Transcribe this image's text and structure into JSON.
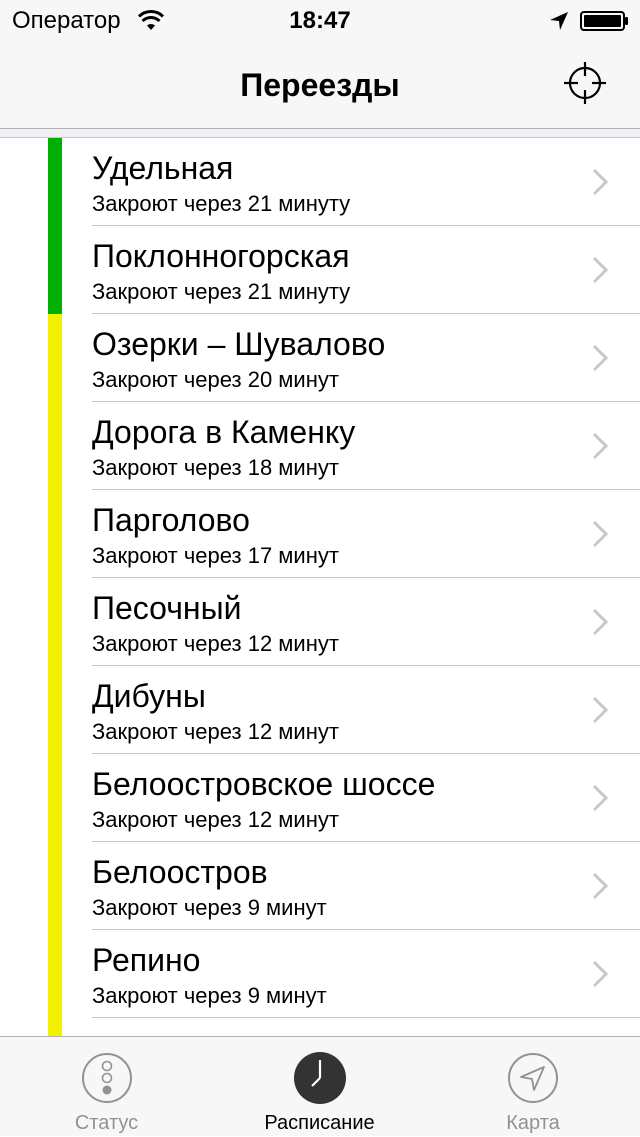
{
  "status_bar": {
    "carrier": "Оператор",
    "time": "18:47"
  },
  "nav": {
    "title": "Переезды"
  },
  "colors": {
    "green": "#00b000",
    "yellow": "#f2f200",
    "active_tab": "#333333",
    "inactive_tab": "#929292"
  },
  "crossings": [
    {
      "name": "Удельная",
      "status": "Закроют через 21 минуту",
      "color": "#00b000"
    },
    {
      "name": "Поклонногорская",
      "status": "Закроют через 21 минуту",
      "color": "#00b000"
    },
    {
      "name": "Озерки – Шувалово",
      "status": "Закроют через 20 минут",
      "color": "#f2f200"
    },
    {
      "name": "Дорога в Каменку",
      "status": "Закроют через 18 минут",
      "color": "#f2f200"
    },
    {
      "name": "Парголово",
      "status": "Закроют через 17 минут",
      "color": "#f2f200"
    },
    {
      "name": "Песочный",
      "status": "Закроют через 12 минут",
      "color": "#f2f200"
    },
    {
      "name": "Дибуны",
      "status": "Закроют через 12 минут",
      "color": "#f2f200"
    },
    {
      "name": "Белоостровское шоссе",
      "status": "Закроют через 12 минут",
      "color": "#f2f200"
    },
    {
      "name": "Белоостров",
      "status": "Закроют через 9 минут",
      "color": "#f2f200"
    },
    {
      "name": "Репино",
      "status": "Закроют через 9 минут",
      "color": "#f2f200"
    },
    {
      "name": "",
      "status": "",
      "color": "#f2f200"
    }
  ],
  "tabs": [
    {
      "label": "Статус",
      "icon": "traffic-light-icon",
      "active": false
    },
    {
      "label": "Расписание",
      "icon": "clock-icon",
      "active": true
    },
    {
      "label": "Карта",
      "icon": "location-arrow-icon",
      "active": false
    }
  ]
}
